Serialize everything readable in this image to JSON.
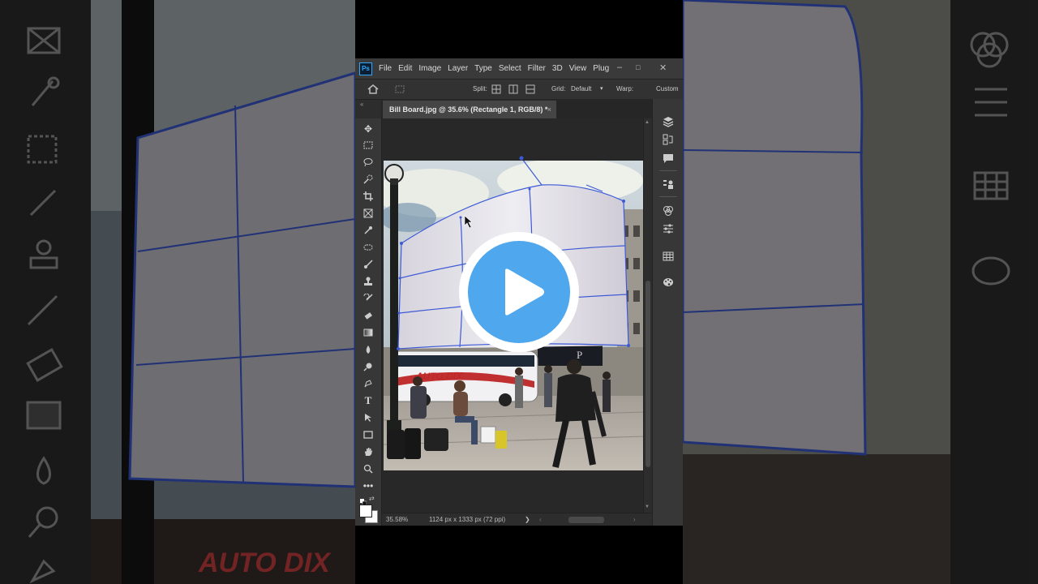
{
  "menu": {
    "logo": "Ps",
    "items": [
      "File",
      "Edit",
      "Image",
      "Layer",
      "Type",
      "Select",
      "Filter",
      "3D",
      "View",
      "Plug"
    ],
    "minimize": "–",
    "maximize": "□",
    "close": "✕"
  },
  "options": {
    "split_label": "Split:",
    "grid_label": "Grid:",
    "grid_value": "Default",
    "warp_label": "Warp:",
    "warp_value": "Custom"
  },
  "document": {
    "tab_title": "Bill Board.jpg @ 35.6% (Rectangle 1, RGB/8) *",
    "close": "×"
  },
  "photo": {
    "bus_text": "AUTO DIX"
  },
  "status": {
    "zoom": "35.58%",
    "dimensions": "1124 px x 1333 px (72 ppi)",
    "arrow": "❯"
  },
  "tools": [
    "move-tool",
    "marquee-tool",
    "lasso-tool",
    "quick-selection-tool",
    "crop-tool",
    "frame-tool",
    "eyedropper-tool",
    "healing-brush-tool",
    "brush-tool",
    "clone-stamp-tool",
    "history-brush-tool",
    "eraser-tool",
    "gradient-tool",
    "blur-tool",
    "dodge-tool",
    "pen-tool",
    "type-tool",
    "path-selection-tool",
    "rectangle-tool",
    "hand-tool",
    "zoom-tool",
    "more-tools"
  ],
  "panels": [
    "layers-panel",
    "history-panel",
    "comments-panel",
    "properties-panel",
    "color-panel",
    "adjustments-panel",
    "libraries-panel",
    "swatches-panel"
  ],
  "colors": {
    "accent": "#31a8ff",
    "play_button": "#4fa7ee",
    "warp_grid": "#3d5ad6"
  }
}
